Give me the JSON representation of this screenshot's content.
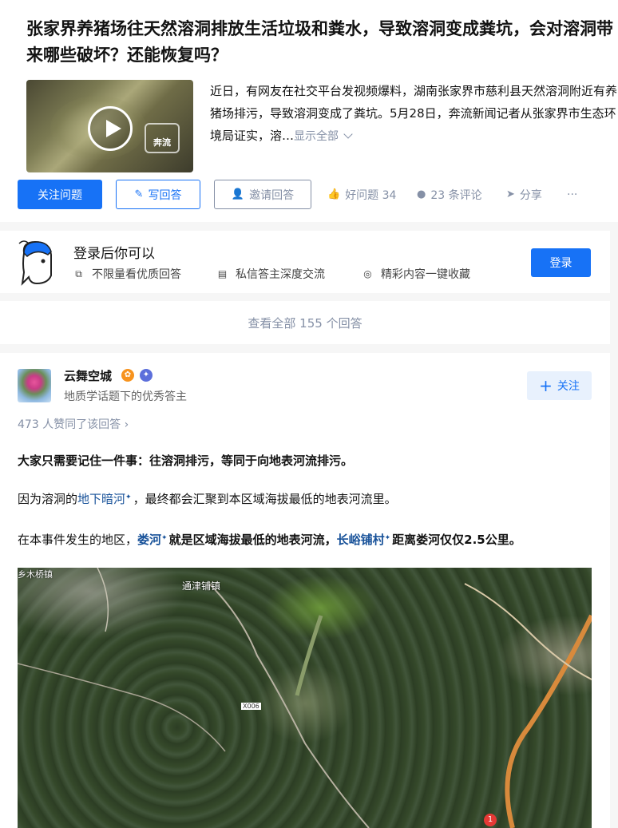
{
  "question": {
    "title": "张家界养猪场往天然溶洞排放生活垃圾和粪水，导致溶洞变成粪坑，会对溶洞带来哪些破坏？还能恢复吗？",
    "video_watermark": "奔流",
    "excerpt": "近日，有网友在社交平台发视频爆料，湖南张家界市慈利县天然溶洞附近有养猪场排污，导致溶洞变成了粪坑。5月28日，奔流新闻记者从张家界市生态环境局证实，溶…",
    "show_all": "显示全部"
  },
  "actions": {
    "follow_question": "关注问题",
    "write_answer": "写回答",
    "invite_answer": "邀请回答",
    "good_question": "好问题 34",
    "comments": "23 条评论",
    "share": "分享",
    "more": "···"
  },
  "login_card": {
    "title": "登录后你可以",
    "perks": [
      "不限量看优质回答",
      "私信答主深度交流",
      "精彩内容一键收藏"
    ],
    "login_button": "登录"
  },
  "view_all": "查看全部 155 个回答",
  "answer": {
    "author_name": "云舞空城",
    "author_desc": "地质学话题下的优秀答主",
    "follow_button": "关注",
    "voters": "473 人赞同了该回答 ›",
    "p1": "大家只需要记住一件事：往溶洞排污，等同于向地表河流排污。",
    "p2_before": "因为溶洞的",
    "p2_link": "地下暗河",
    "p2_after": "，最终都会汇聚到本区域海拔最低的地表河流里。",
    "p3_before": "在本事件发生的地区，",
    "p3_link1": "娄河",
    "p3_mid": "就是区域海拔最低的地表河流，",
    "p3_link2": "长峪铺村",
    "p3_after": "距离娄河仅仅2.5公里。",
    "map_labels": {
      "top_left": "乡木桥镇",
      "town": "通津铺镇",
      "road": "X006",
      "pin": "1"
    }
  }
}
